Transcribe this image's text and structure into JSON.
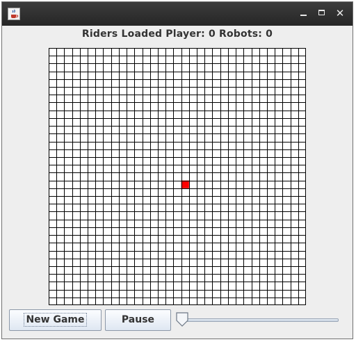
{
  "window": {
    "title": "",
    "app_icon": "java-cup-icon",
    "controls": {
      "minimize": "_",
      "maximize": "□",
      "close": "✕"
    }
  },
  "status": {
    "text": "Riders Loaded Player: 0 Robots: 0"
  },
  "board": {
    "columns": 33,
    "rows": 33,
    "cell_color": "#ffffff",
    "line_color": "#000000",
    "player": {
      "column": 17,
      "row": 17,
      "color": "#ff0000"
    }
  },
  "buttons": {
    "new_game": "New Game",
    "pause": "Pause"
  },
  "speed_slider": {
    "value_fraction": 0.0
  }
}
